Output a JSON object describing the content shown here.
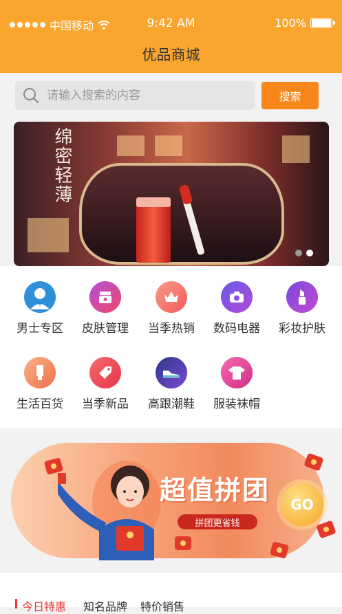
{
  "status_bar": {
    "carrier": "中国移动",
    "time": "9:42 AM",
    "battery": "100%"
  },
  "header": {
    "title": "优品商城"
  },
  "search": {
    "placeholder": "请输入搜索的内容",
    "button": "搜索"
  },
  "banner": {
    "headline": "绵密轻薄",
    "slide_index": 2,
    "slide_count": 2
  },
  "categories": [
    {
      "label": "男士专区",
      "icon": "man-icon",
      "color": "#2f8fd8"
    },
    {
      "label": "皮肤管理",
      "icon": "skincare-jar-icon",
      "color": "#d63ea0"
    },
    {
      "label": "当季热销",
      "icon": "crown-icon",
      "color": "#f36a6a"
    },
    {
      "label": "数码电器",
      "icon": "camera-icon",
      "color": "#8a4fe0"
    },
    {
      "label": "彩妆护肤",
      "icon": "lipstick-icon",
      "color": "#9b44d8"
    },
    {
      "label": "生活百货",
      "icon": "tube-icon",
      "color": "#f0865a"
    },
    {
      "label": "当季新品",
      "icon": "tag-icon",
      "color": "#e8444e"
    },
    {
      "label": "高跟潮鞋",
      "icon": "sneaker-icon",
      "color": "#3c3f9a"
    },
    {
      "label": "服装袜帽",
      "icon": "shirt-icon",
      "color": "#e0489a"
    }
  ],
  "promo": {
    "title": "超值拼团",
    "subtitle": "拼团更省钱",
    "go": "GO"
  },
  "tabs": [
    "今日特惠",
    "知名品牌",
    "特价销售"
  ],
  "colors": {
    "header": "#f9a52e",
    "search_button": "#f7871b",
    "accent_red": "#e53935"
  }
}
